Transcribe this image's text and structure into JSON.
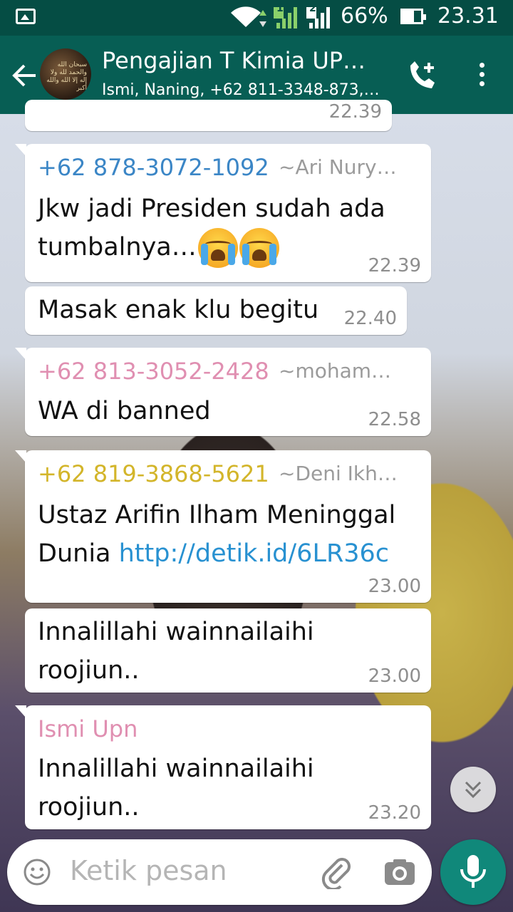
{
  "status_bar": {
    "battery": "66%",
    "time": "23.31",
    "sim1": "1",
    "sim2": "2"
  },
  "header": {
    "title": "Pengajian T Kimia UP…",
    "subtitle": "Ismi, Naning, +62 811-3348-873,…",
    "avatar_text": "سبحان الله والحمد لله ولا إله إلا الله والله أكبر"
  },
  "top_partial_time": "22.39",
  "messages": [
    {
      "sender_phone": "+62 878-3072-1092",
      "sender_name": "~Ari Nury…",
      "sender_color": "#3b86c6",
      "text": "Jkw jadi Presiden sudah ada tumbalnya…",
      "time": "22.39",
      "emojis": [
        "loudly-crying-face",
        "loudly-crying-face"
      ]
    },
    {
      "text": "Masak enak klu begitu",
      "time": "22.40"
    },
    {
      "sender_phone": "+62 813-3052-2428",
      "sender_name": "~moham…",
      "sender_color": "#e08fb1",
      "text": "WA di banned",
      "time": "22.58"
    },
    {
      "sender_phone": "+62 819-3868-5621",
      "sender_name": "~Deni Ikh…",
      "sender_color": "#d3b52a",
      "text_line1": "Ustaz Arifin Ilham Meninggal",
      "text_line2_prefix": "Dunia ",
      "link": "http://detik.id/6LR36c",
      "time": "23.00"
    },
    {
      "text_line1": "Innalillahi wainnailaihi",
      "text_line2": "roojiun..",
      "time": "23.00"
    },
    {
      "sender_label": "Ismi Upn",
      "sender_color": "#e08fb1",
      "text_line1": "Innalillahi wainnailaihi",
      "text_line2": "roojiun..",
      "time": "23.20"
    }
  ],
  "input": {
    "placeholder": "Ketik pesan"
  },
  "colors": {
    "app_bar": "#075e54",
    "status_bar": "#054d44",
    "mic_button": "#10887a",
    "link": "#2891d1"
  }
}
